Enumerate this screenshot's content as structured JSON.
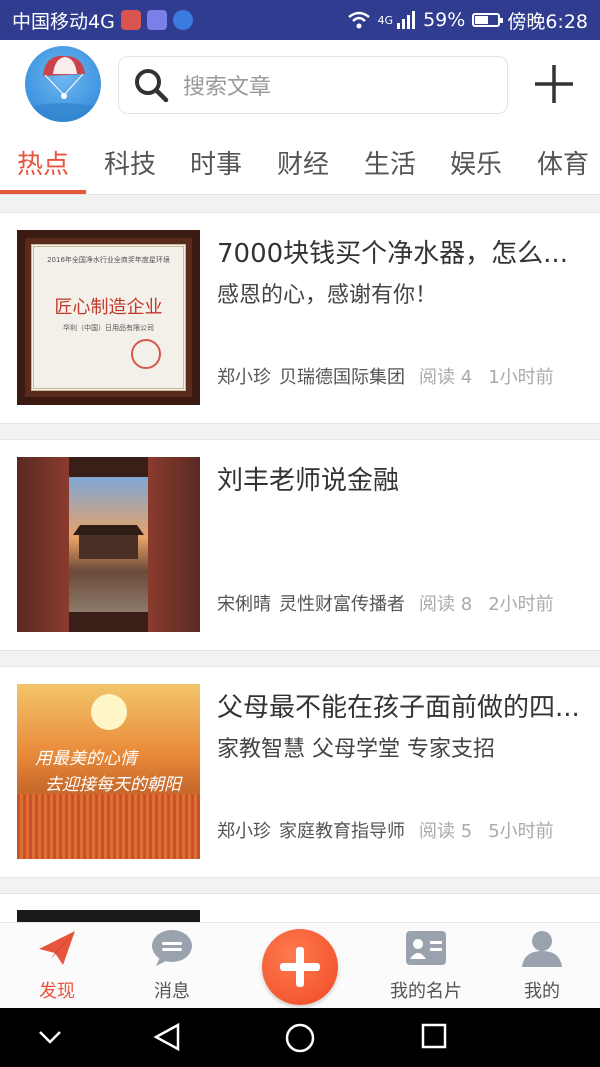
{
  "status_bar": {
    "carrier": "中国移动4G",
    "network": "4G",
    "battery_pct": "59%",
    "battery_level": 0.59,
    "time": "傍晚6:28"
  },
  "header": {
    "avatar_icon": "parachute-avatar",
    "search_placeholder": "搜索文章",
    "add_icon": "plus-icon"
  },
  "tabs": [
    {
      "label": "热点",
      "active": true
    },
    {
      "label": "科技",
      "active": false
    },
    {
      "label": "时事",
      "active": false
    },
    {
      "label": "财经",
      "active": false
    },
    {
      "label": "生活",
      "active": false
    },
    {
      "label": "娱乐",
      "active": false
    },
    {
      "label": "体育",
      "active": false
    }
  ],
  "articles": [
    {
      "title": "7000块钱买个净水器，怎么...",
      "subtitle": "感恩的心，感谢有你！",
      "author": "郑小珍",
      "org": "贝瑞德国际集团",
      "reads": "阅读 4",
      "time": "1小时前",
      "thumb": "certificate-image",
      "thumb_text": {
        "header": "2016年全国净水行业全商奖年度星环境",
        "motto": "匠心制造企业",
        "company": "华利（中国）日用品有限公司"
      }
    },
    {
      "title": "刘丰老师说金融",
      "subtitle": "",
      "author": "宋俐晴",
      "org": "灵性财富传播者",
      "reads": "阅读 8",
      "time": "2小时前",
      "thumb": "palace-gate-image"
    },
    {
      "title": "父母最不能在孩子面前做的四...",
      "subtitle": "家教智慧 父母学堂 专家支招",
      "author": "郑小珍",
      "org": "家庭教育指导师",
      "reads": "阅读 5",
      "time": "5小时前",
      "thumb": "sunrise-field-image",
      "thumb_text": {
        "line1": "用最美的心情",
        "line2": "去迎接每天的朝阳"
      }
    }
  ],
  "bottom_nav": [
    {
      "label": "发现",
      "icon": "paper-plane-icon",
      "active": true
    },
    {
      "label": "消息",
      "icon": "chat-bubble-icon",
      "active": false
    },
    {
      "label": "",
      "icon": "add-circle-icon",
      "active": false
    },
    {
      "label": "我的名片",
      "icon": "business-card-icon",
      "active": false
    },
    {
      "label": "我的",
      "icon": "person-icon",
      "active": false
    }
  ],
  "system_nav": [
    "chevron-down-icon",
    "back-icon",
    "home-icon",
    "recents-icon"
  ],
  "colors": {
    "accent": "#e8553d",
    "status_bar": "#2f3c8f",
    "fab": "#ee4b24"
  }
}
